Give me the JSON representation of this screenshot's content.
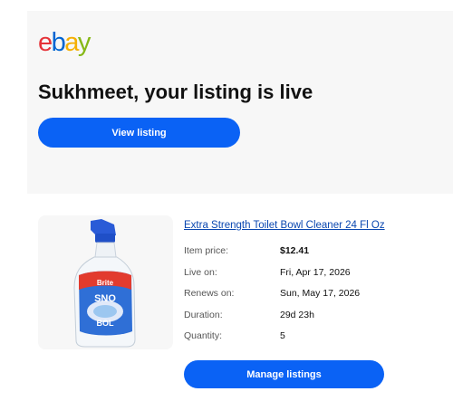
{
  "logo": {
    "letters": [
      "e",
      "b",
      "a",
      "y"
    ],
    "colors": [
      "#e53238",
      "#0064d2",
      "#f5af02",
      "#86b817"
    ]
  },
  "headline": "Sukhmeet, your listing is live",
  "view_button": "View listing",
  "product": {
    "title": "Extra Strength Toilet Bowl Cleaner 24 Fl Oz",
    "image_label": "Brite SNO BOL",
    "details": [
      {
        "label": "Item price:",
        "value": "$12.41"
      },
      {
        "label": "Live on:",
        "value": "Fri, Apr 17, 2026"
      },
      {
        "label": "Renews on:",
        "value": "Sun, May 17, 2026"
      },
      {
        "label": "Duration:",
        "value": "29d 23h"
      },
      {
        "label": "Quantity:",
        "value": "5"
      }
    ]
  },
  "manage_button": "Manage listings",
  "accent_color": "#0a62f5"
}
